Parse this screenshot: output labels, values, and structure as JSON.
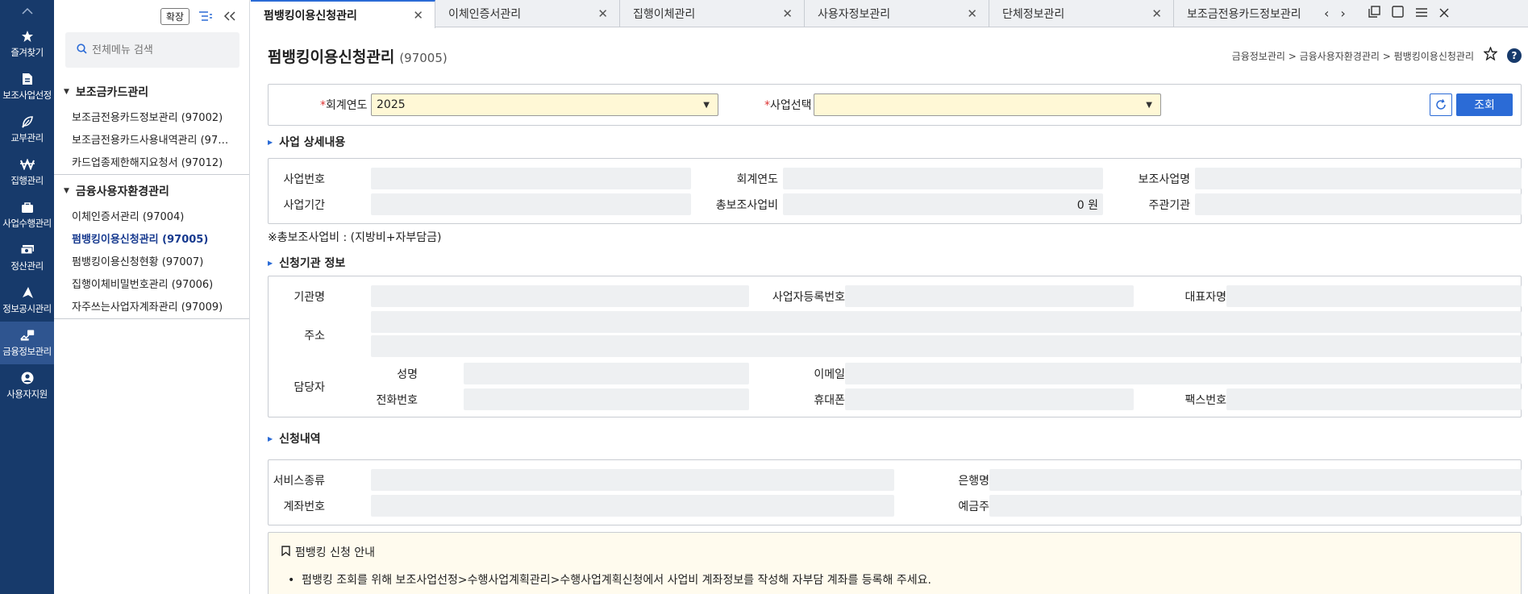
{
  "rail": {
    "items": [
      {
        "label": "즐겨찾기",
        "icon": "star-icon"
      },
      {
        "label": "보조사업선정",
        "icon": "document-icon"
      },
      {
        "label": "교부관리",
        "icon": "feather-icon"
      },
      {
        "label": "집행관리",
        "icon": "won-icon"
      },
      {
        "label": "사업수행관리",
        "icon": "briefcase-icon"
      },
      {
        "label": "정산관리",
        "icon": "cash-icon"
      },
      {
        "label": "정보공시관리",
        "icon": "paper-plane-icon"
      },
      {
        "label": "금융정보관리",
        "icon": "finance-icon",
        "active": true
      },
      {
        "label": "사용자지원",
        "icon": "user-icon"
      }
    ]
  },
  "menu": {
    "expand_label": "확장",
    "search_placeholder": "전체메뉴 검색",
    "groups": [
      {
        "title": "보조금카드관리",
        "items": [
          "보조금전용카드정보관리 (97002)",
          "보조금전용카드사용내역관리 (97…",
          "카드업종제한해지요청서 (97012)"
        ]
      },
      {
        "title": "금융사용자환경관리",
        "items": [
          "이체인증서관리 (97004)",
          "펌뱅킹이용신청관리 (97005)",
          "펌뱅킹이용신청현황 (97007)",
          "집행이체비밀번호관리 (97006)",
          "자주쓰는사업자계좌관리 (97009)"
        ]
      }
    ]
  },
  "tabs": [
    "펌뱅킹이용신청관리",
    "이체인증서관리",
    "집행이체관리",
    "사용자정보관리",
    "단체정보관리",
    "보조금전용카드정보관리"
  ],
  "page": {
    "title": "펌뱅킹이용신청관리",
    "code": "(97005)",
    "breadcrumb": "금융정보관리 > 금융사용자환경관리 > 펌뱅킹이용신청관리"
  },
  "search": {
    "year_label": "회계연도",
    "year_value": "2025",
    "project_label": "사업선택",
    "project_value": "",
    "query_label": "조회"
  },
  "detail": {
    "title": "사업 상세내용",
    "labels": {
      "project_no": "사업번호",
      "fiscal_year": "회계연도",
      "project_name": "보조사업명",
      "period": "사업기간",
      "total": "총보조사업비",
      "agency": "주관기관"
    },
    "total_value": "0 원",
    "note": "※총보조사업비 : (지방비+자부담금)"
  },
  "applicant": {
    "title": "신청기관 정보",
    "labels": {
      "org_name": "기관명",
      "biz_no": "사업자등록번호",
      "ceo": "대표자명",
      "address": "주소",
      "contact": "담당자",
      "name": "성명",
      "email": "이메일",
      "phone": "전화번호",
      "mobile": "휴대폰",
      "fax": "팩스번호"
    }
  },
  "request": {
    "title": "신청내역",
    "labels": {
      "service": "서비스종류",
      "bank": "은행명",
      "account": "계좌번호",
      "holder": "예금주"
    }
  },
  "guide": {
    "title": "펌뱅킹 신청 안내",
    "items": [
      "펌뱅킹 조회를 위해 보조사업선정>수행사업계획관리>수행사업계획신청에서 사업비 계좌정보를 작성해 자부담 계좌를 등록해 주세요."
    ]
  },
  "colors": {
    "rail": "#173a6b",
    "accent": "#2b6bd6",
    "select_bg": "#fff8d6"
  }
}
